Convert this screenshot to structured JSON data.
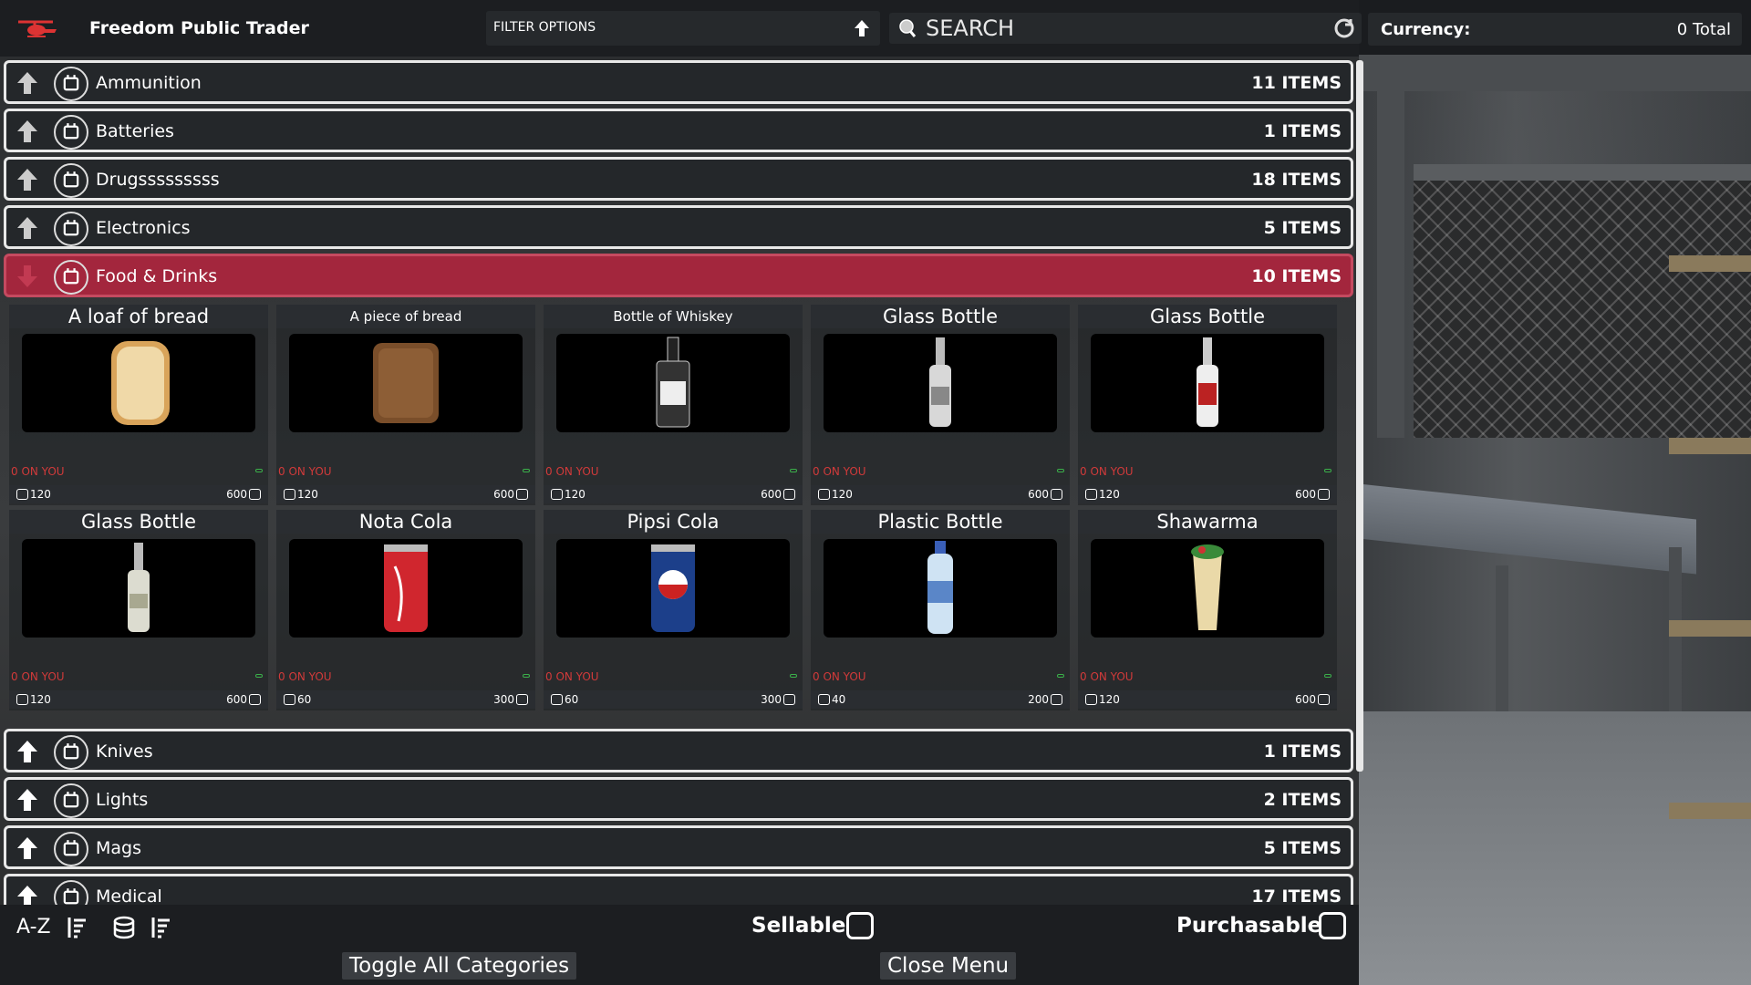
{
  "header": {
    "title": "Freedom Public Trader",
    "filter_label": "FILTER OPTIONS",
    "search_placeholder": "SEARCH",
    "currency_label": "Currency:",
    "currency_value": "0 Total"
  },
  "categories_top": [
    {
      "name": "Ammunition",
      "count": "11 ITEMS"
    },
    {
      "name": "Batteries",
      "count": "1 ITEMS"
    },
    {
      "name": "Drugsssssssss",
      "count": "18 ITEMS"
    },
    {
      "name": "Electronics",
      "count": "5 ITEMS"
    },
    {
      "name": "Food & Drinks",
      "count": "10 ITEMS"
    }
  ],
  "items": [
    {
      "name": "A loaf of bread",
      "onyou": "0 ON YOU",
      "buy": "120",
      "sell": "600"
    },
    {
      "name": "A piece of bread",
      "onyou": "0 ON YOU",
      "buy": "120",
      "sell": "600"
    },
    {
      "name": "Bottle of Whiskey",
      "onyou": "0 ON YOU",
      "buy": "120",
      "sell": "600"
    },
    {
      "name": "Glass Bottle",
      "onyou": "0 ON YOU",
      "buy": "120",
      "sell": "600"
    },
    {
      "name": "Glass Bottle",
      "onyou": "0 ON YOU",
      "buy": "120",
      "sell": "600"
    },
    {
      "name": "Glass Bottle",
      "onyou": "0 ON YOU",
      "buy": "120",
      "sell": "600"
    },
    {
      "name": "Nota Cola",
      "onyou": "0 ON YOU",
      "buy": "60",
      "sell": "300"
    },
    {
      "name": "Pipsi Cola",
      "onyou": "0 ON YOU",
      "buy": "60",
      "sell": "300"
    },
    {
      "name": "Plastic Bottle",
      "onyou": "0 ON YOU",
      "buy": "40",
      "sell": "200"
    },
    {
      "name": "Shawarma",
      "onyou": "0 ON YOU",
      "buy": "120",
      "sell": "600"
    }
  ],
  "categories_bottom": [
    {
      "name": "Knives",
      "count": "1 ITEMS"
    },
    {
      "name": "Lights",
      "count": "2 ITEMS"
    },
    {
      "name": "Mags",
      "count": "5 ITEMS"
    },
    {
      "name": "Medical",
      "count": "17 ITEMS"
    }
  ],
  "footer": {
    "sort_az": "A-Z",
    "sellable": "Sellable",
    "purchasable": "Purchasable",
    "toggle_all": "Toggle All Categories",
    "close_menu": "Close Menu"
  },
  "colors": {
    "accent_open_category": "#a3263d",
    "on_you_red": "#d13a3a"
  }
}
